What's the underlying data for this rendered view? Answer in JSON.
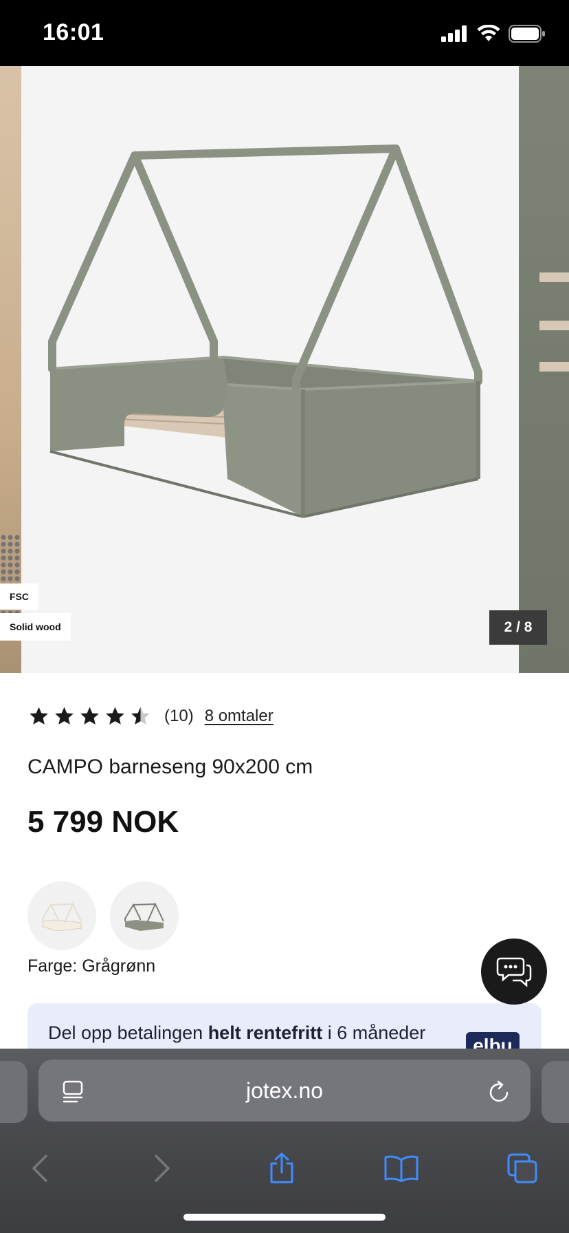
{
  "status_bar": {
    "time": "16:01"
  },
  "gallery": {
    "badges": [
      "FSC",
      "Solid wood"
    ],
    "counter": "2 / 8"
  },
  "product": {
    "rating": 4.5,
    "rating_count": "(10)",
    "reviews_link": "8 omtaler",
    "title": "CAMPO barneseng 90x200 cm",
    "price": "5 799 NOK",
    "color_label": "Farge: Grågrønn",
    "swatches": [
      "white-bed-swatch",
      "grey-green-bed-swatch"
    ]
  },
  "promo": {
    "text_before": "Del opp betalingen ",
    "text_bold": "helt rentefritt",
    "text_after": " i 6 måneder",
    "logo": "elbu"
  },
  "browser": {
    "url": "jotex.no"
  },
  "colors": {
    "accent_blue": "#3f8cff",
    "bed_green": "#8b9283",
    "promo_bg": "#e9ecfb"
  }
}
